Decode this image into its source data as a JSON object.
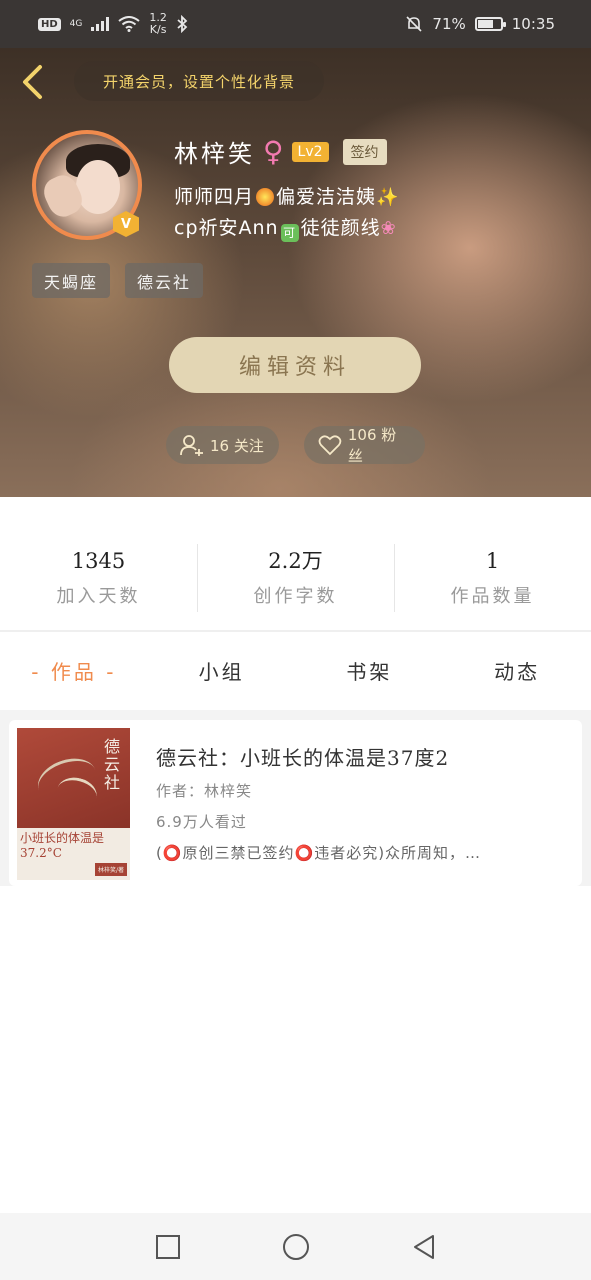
{
  "status_bar": {
    "hd": "HD",
    "network": "4G",
    "speed_value": "1.2",
    "speed_unit": "K/s",
    "battery": "71%",
    "time": "10:35"
  },
  "header": {
    "vip_banner": "开通会员，设置个性化背景",
    "name": "林梓笑",
    "level": "Lv2",
    "signed": "签约",
    "bio_line1_a": "师师四月",
    "bio_line1_b": "偏爱洁洁姨",
    "bio_line2_a": "cp祈安Ann",
    "bio_line2_ok": "可",
    "bio_line2_b": "徒徒颜线",
    "tags": [
      "天蝎座",
      "德云社"
    ],
    "edit_label": "编辑资料",
    "following": "16 关注",
    "fans": "106 粉丝"
  },
  "stats": [
    {
      "value": "1345",
      "label": "加入天数"
    },
    {
      "value": "2.2万",
      "label": "创作字数"
    },
    {
      "value": "1",
      "label": "作品数量"
    }
  ],
  "tabs": [
    "- 作品 -",
    "小组",
    "书架",
    "动态"
  ],
  "work": {
    "title": "德云社：小班长的体温是37度2",
    "author": "作者：林梓笑",
    "views": "6.9万人看过",
    "desc": "(⭕原创三禁已签约⭕违者必究)众所周知，…",
    "cover_title": "德云社",
    "cover_subtitle": "小班长的体温是37.2°C",
    "cover_author": "林梓笑/著"
  },
  "colors": {
    "accent": "#f08b4d",
    "vip_text": "#f3d36b",
    "level_badge": "#f2b233"
  }
}
